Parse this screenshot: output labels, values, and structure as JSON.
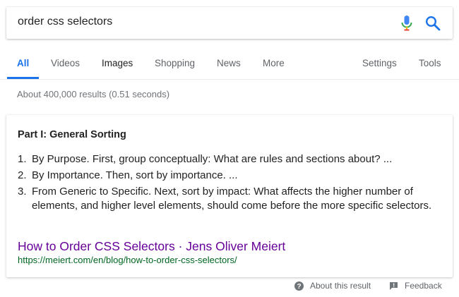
{
  "search": {
    "query": "order css selectors"
  },
  "icons": {
    "mic": "microphone-icon",
    "search": "search-icon",
    "help": "help-circle-icon",
    "feedback": "feedback-icon"
  },
  "colors": {
    "accent": "#1a73e8",
    "visited_link": "#660099",
    "url_green": "#006621"
  },
  "tabs": {
    "all": "All",
    "videos": "Videos",
    "images": "Images",
    "shopping": "Shopping",
    "news": "News",
    "more": "More",
    "settings": "Settings",
    "tools": "Tools"
  },
  "stats": "About 400,000 results (0.51 seconds)",
  "snippet": {
    "heading": "Part I: General Sorting",
    "items": [
      {
        "num": "1.",
        "text": "By Purpose. First, group conceptually: What are rules and sections about? ..."
      },
      {
        "num": "2.",
        "text": "By Importance. Then, sort by importance. ..."
      },
      {
        "num": "3.",
        "text": "From Generic to Specific. Next, sort by impact: What affects the higher number of elements, and higher level elements, should come before the more specific selectors."
      }
    ],
    "result_title": "How to Order CSS Selectors · Jens Oliver Meiert",
    "result_url": "https://meiert.com/en/blog/how-to-order-css-selectors/"
  },
  "footer": {
    "about": "About this result",
    "feedback": "Feedback"
  }
}
